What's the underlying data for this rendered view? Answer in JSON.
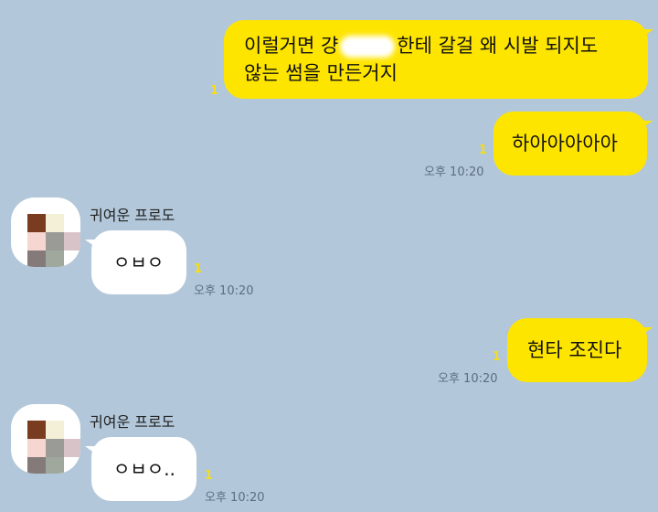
{
  "messages": [
    {
      "side": "me",
      "text_before": "이럴거면 걍",
      "text_after": "한테 갈걸 왜 시발 되지도 않는 썸을 만든거지",
      "line1": "이럴거면 걍",
      "line1_after": "한테 갈걸 왜 시발 되지도",
      "line2": "않는 썸을 만든거지",
      "unread": "1"
    },
    {
      "side": "me",
      "text": "하아아아아아",
      "unread": "1",
      "time": "오후 10:20"
    },
    {
      "side": "you",
      "name": "귀여운 프로도",
      "text": "ㅇㅂㅇ",
      "unread": "1",
      "time": "오후 10:20"
    },
    {
      "side": "me",
      "text": "현타 조진다",
      "unread": "1",
      "time": "오후 10:20"
    },
    {
      "side": "you",
      "name": "귀여운 프로도",
      "text": "ㅇㅂㅇ..",
      "unread": "1",
      "time": "오후 10:20"
    }
  ],
  "colors": {
    "background": "#b2c7d9",
    "my_bubble": "#fee500",
    "their_bubble": "#ffffff",
    "unread": "#f5dc1c"
  }
}
